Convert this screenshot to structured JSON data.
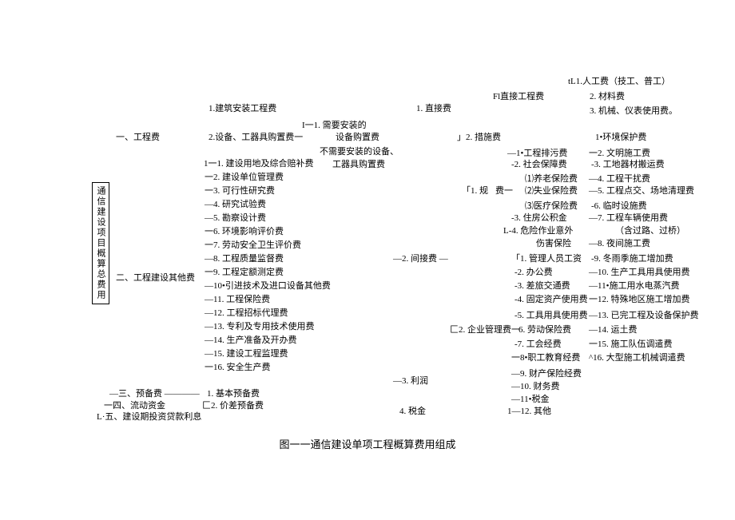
{
  "caption": "图一一通信建设单项工程概算费用组成",
  "root_label": "通信建设项目概算总费用",
  "level1": {
    "item1": "一、工程费",
    "item2": "二、工程建设其他费",
    "item3": "—三、预备费 ————",
    "item4": "一四、流动资金",
    "item5": "L·五、建设期投资贷款利息"
  },
  "engineering_fee": {
    "item1": "1.建筑安装工程费",
    "item2": "2.设备、工器具购置费一",
    "sub2_intro": "I一1. 需要安装的",
    "sub2_1": "设备购置费",
    "sub2_2": "不需要安装的设备、",
    "sub2_3": "工器具购置费"
  },
  "other_fee": {
    "item1": "1一1. 建设用地及综合赔补费",
    "item2": "一2. 建设单位管理费",
    "item3": "一3. 可行性研究费",
    "item4": "—4. 研究试验费",
    "item5": "—5. 勘察设计费",
    "item6": "一6. 环境影响评价费",
    "item7": "一7. 劳动安全卫生评价费",
    "item8": "—8. 工程质量监督费",
    "item9": "一9. 工程定额测定费",
    "item10": "—10•引进技术及进口设备其他费",
    "item11": "—11. 工程保险费",
    "item12": "—12. 工程招标代理费",
    "item13": "—13. 专利及专用技术使用费",
    "item14": "—14. 生产准备及开办费",
    "item15": "—15. 建设工程监理费",
    "item16": "一16. 安全生产费"
  },
  "reserve": {
    "item1": "1. 基本预备费",
    "item2": "匚2. 价差预备费"
  },
  "install_fee": {
    "item1": "1. 直接费",
    "item2": "—2. 间接费    —",
    "item3": "—3. 利润",
    "item4": "4. 税金"
  },
  "direct_fee": {
    "item1": "Fl直接工程费",
    "item2": "」2. 措施费"
  },
  "direct_engineering": {
    "item1": "tL1.人工费（技工、普工）",
    "item2": "2. 材料费",
    "item3": "3. 机械、仪表使用费。"
  },
  "measure_fee_header": "1•环境保护费",
  "measure_fee": {
    "item1": "一2. 文明施工费",
    "item2": "-3. 工地器材搬运费",
    "item3": "—4. 工程干扰费",
    "item4": "—5. 工程点交、场地清理费",
    "item5": "-6. 临时设施费",
    "item6": "—7. 工程车辆使用费",
    "item6b": "（含过路、过桥）",
    "item7": "—8. 夜间施工费",
    "item8": "-9. 冬雨季施工增加费",
    "item9": "—10. 生产工具用具使用费",
    "item10": "—11•施工用水电蒸汽费",
    "item11": "一12. 特殊地区施工增加费",
    "item12": "—13. 已完工程及设备保护费",
    "item13": "—14. 运土费",
    "item14": "一15. 施工队伍调遣费",
    "item15": "^16. 大型施工机械调遣费"
  },
  "indirect_fee": {
    "item1_pre": "「1. 规",
    "item1": "费一",
    "item2": "匚2. 企业管理费一"
  },
  "regulation_fee": {
    "item1": "—1•工程排污费",
    "item2": "-2. 社会保障费",
    "item2_1": "⑴养老保险费",
    "item2_2": "⑵失业保险费",
    "item2_3": "⑶医疗保险费",
    "item3": "-3. 住房公积金",
    "item4": "L-4. 危险作业意外",
    "item4b": "伤害保险"
  },
  "enterprise_fee": {
    "item1": "「1. 管理人员工资",
    "item2": "-2. 办公费",
    "item3": "-3. 差旅交通费",
    "item4": "-4. 固定资产使用费",
    "item5": "-5. 工具用具使用费",
    "item6": "6. 劳动保险费",
    "item7": "-7. 工会经费",
    "item8": "一8•职工教育经费",
    "item9": "—9. 财产保险经费",
    "item10": "—10. 财务费",
    "item11": "—11•税金",
    "item12": "1—12. 其他"
  }
}
